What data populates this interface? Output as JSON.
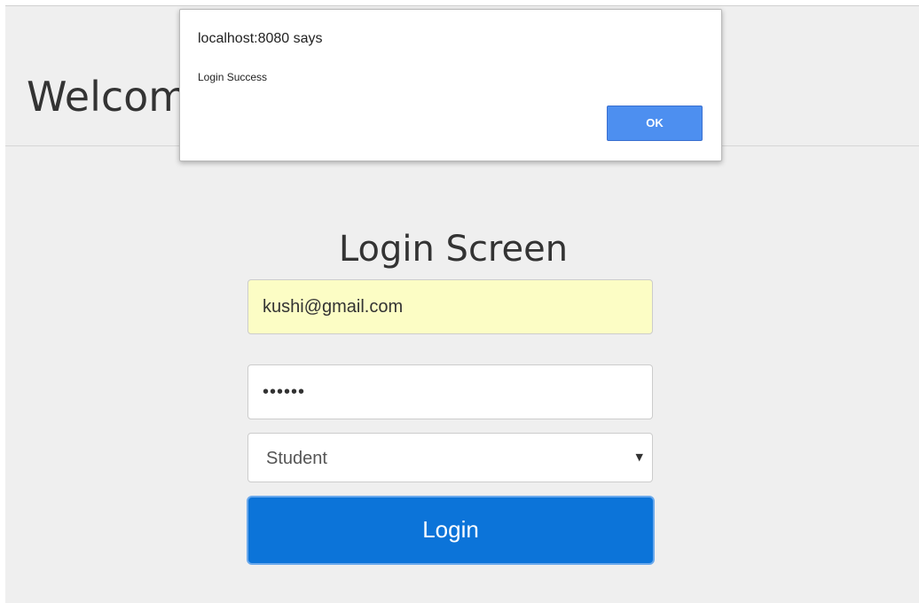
{
  "header": {
    "title": "Welcome to Portal"
  },
  "login": {
    "title": "Login Screen",
    "email_value": "kushi@gmail.com",
    "password_value": "••••••",
    "role_selected": "Student",
    "login_label": "Login"
  },
  "dialog": {
    "title": "localhost:8080 says",
    "message": "Login Success",
    "ok_label": "OK"
  },
  "icons": {
    "select_caret": "chevron-down-icon"
  },
  "colors": {
    "login_button": "#0c74d9",
    "email_autofill": "#fcfdc5",
    "ok_button": "#4d8ff0"
  }
}
